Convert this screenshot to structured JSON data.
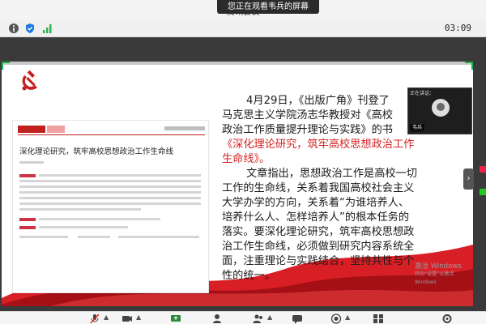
{
  "app": {
    "title": "腾讯会议",
    "share_banner": "您正在观看韦兵的屏幕"
  },
  "status": {
    "clock": "03:09",
    "icons": [
      "info-icon",
      "shield-icon",
      "signal-icon"
    ]
  },
  "colors": {
    "accent_red": "#d62222",
    "frame_green": "#18b24a",
    "stage_bg": "#3a3a3a"
  },
  "slide": {
    "doc_title": "深化理论研究，筑牢高校思想政治工作生命线",
    "lines": [
      "4月29日，《出版广角》刊登了",
      "马克思主义学院汤志华教授对《高校",
      "政治工作质量提升理论与实践》的书",
      "《深化理论研究，筑牢高校思想政治工作",
      "生命线》。",
      "文章指出，思想政治工作是高校一切",
      "工作的生命线，关系着我国高校社会主义",
      "大学办学的方向，关系着“为谁培养人、",
      "培养什么人、怎样培养人”的根本任务的",
      "落实。要深化理论研究，筑牢高校思想政",
      "治工作生命线，必须做到研究内容系统全",
      "面，注重理论与实践结合，坚持共性与个",
      "性的统一。"
    ],
    "activate_line1": "激活 Windows",
    "activate_line2": "转到“设置”以激活 Windows"
  },
  "video": {
    "header": "正在讲话：",
    "label": "韦兵"
  },
  "toolbar": {
    "icons": [
      "mic-muted-icon",
      "video-icon",
      "share-screen-icon",
      "invite-icon",
      "participants-icon",
      "chat-icon",
      "record-icon",
      "apps-icon",
      "settings-icon"
    ]
  }
}
